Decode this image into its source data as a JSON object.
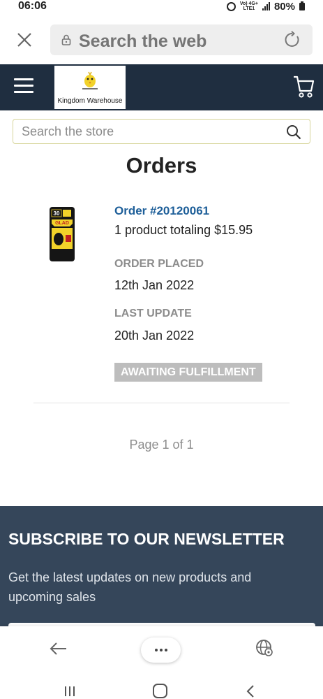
{
  "status_bar": {
    "time": "06:06",
    "network_top": "Vo) 4G+",
    "network_bottom": "LTE1",
    "battery": "80%"
  },
  "browser": {
    "address_text": "Search the web",
    "icons": [
      "close-icon",
      "lock-icon",
      "reload-icon"
    ]
  },
  "site": {
    "logo_text": "Kingdom Warehouse",
    "icons": [
      "menu-icon",
      "cart-icon"
    ]
  },
  "store_search": {
    "placeholder": "Search the store"
  },
  "page": {
    "title": "Orders"
  },
  "order": {
    "number": "Order #20120061",
    "summary": "1 product totaling $15.95",
    "placed_label": "ORDER PLACED",
    "placed_value": "12th Jan 2022",
    "update_label": "LAST UPDATE",
    "update_value": "20th Jan 2022",
    "status": "AWAITING FULFILLMENT",
    "product_image": {
      "count_label": "30",
      "brand": "GLAD"
    }
  },
  "pagination": {
    "text": "Page 1 of 1"
  },
  "newsletter": {
    "title": "SUBSCRIBE TO OUR NEWSLETTER",
    "text": "Get the latest updates on new products and upcoming sales"
  },
  "toolbar": {
    "icons": [
      "back-arrow-icon",
      "more-icon",
      "globe-icon"
    ]
  },
  "android_nav": {
    "icons": [
      "recents-icon",
      "home-icon",
      "back-icon"
    ]
  },
  "colors": {
    "header_bg": "#1f2e40",
    "newsletter_bg": "#35465a",
    "link": "#1e5f99",
    "badge_bg": "#bdbdbd"
  }
}
